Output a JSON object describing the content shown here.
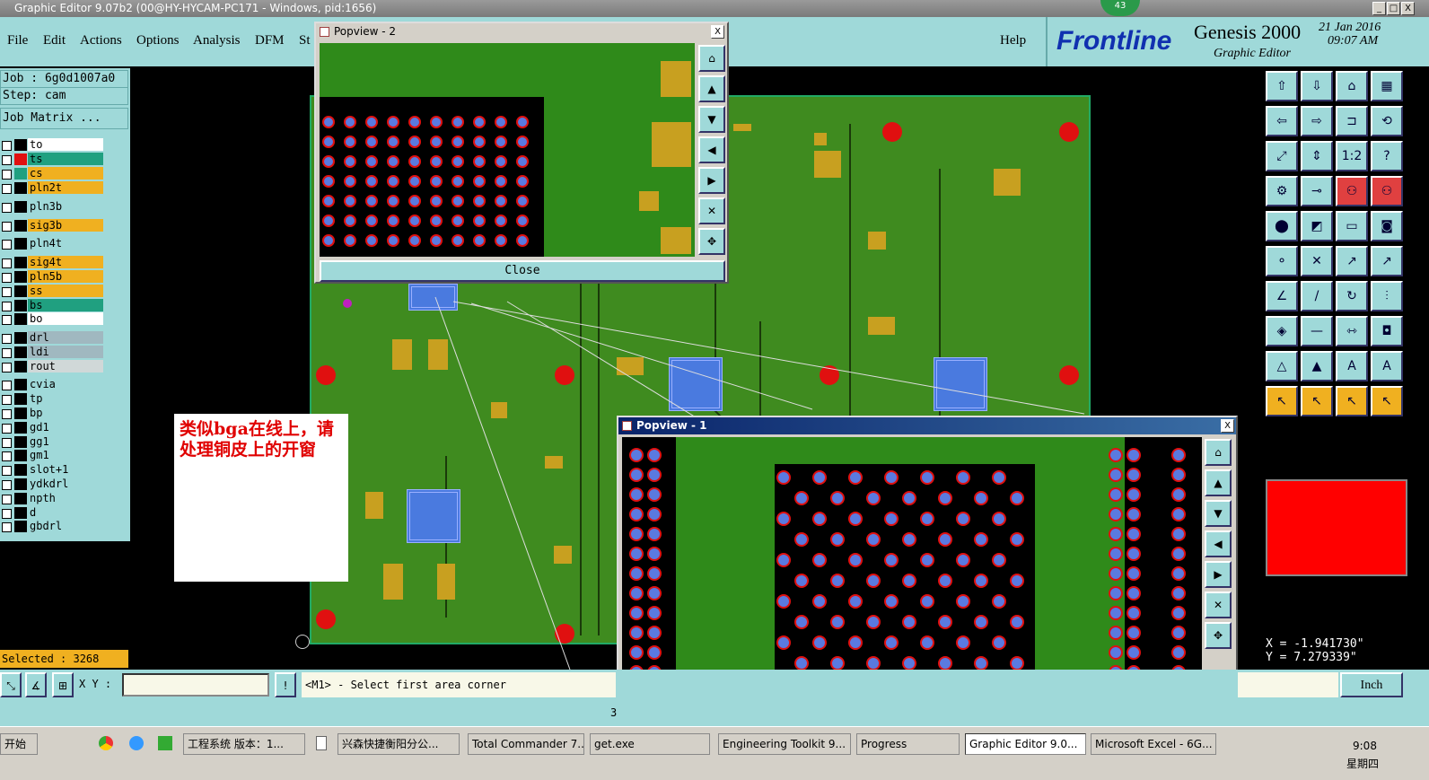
{
  "window": {
    "title": "Graphic Editor 9.07b2 (00@HY-HYCAM-PC171 - Windows, pid:1656)",
    "badge": "43",
    "minimize": "_",
    "maximize": "□",
    "close": "X"
  },
  "menu": {
    "file": "File",
    "edit": "Edit",
    "actions": "Actions",
    "options": "Options",
    "analysis": "Analysis",
    "dfm": "DFM",
    "step": "St",
    "help": "Help"
  },
  "header": {
    "brand": "Frontline",
    "product": "Genesis 2000",
    "subtitle": "Graphic Editor",
    "date": "21 Jan 2016",
    "time": "09:07 AM"
  },
  "left": {
    "job": "Job : 6g0d1007a0",
    "step": "Step: cam",
    "job_matrix": "Job Matrix ...",
    "selected": "Selected : 3268",
    "layers": [
      {
        "name": "to",
        "color": "#ffffff",
        "bg": "#ffffff"
      },
      {
        "name": "ts",
        "color": "#e01010",
        "bg": "#20a080"
      },
      {
        "name": "cs",
        "color": "#20a080",
        "bg": "#f0b020"
      },
      {
        "name": "pln2t",
        "color": "#000000",
        "bg": "#f0b020"
      },
      {
        "name": "pln3b",
        "color": "#000000",
        "bg": "#9fd9d9"
      },
      {
        "name": "sig3b",
        "color": "#000000",
        "bg": "#f0b020"
      },
      {
        "name": "pln4t",
        "color": "#000000",
        "bg": "#9fd9d9"
      },
      {
        "name": "sig4t",
        "color": "#000000",
        "bg": "#f0b020"
      },
      {
        "name": "pln5b",
        "color": "#000000",
        "bg": "#f0b020"
      },
      {
        "name": "ss",
        "color": "#000000",
        "bg": "#f0b020"
      },
      {
        "name": "bs",
        "color": "#000000",
        "bg": "#20a080"
      },
      {
        "name": "bo",
        "color": "#000000",
        "bg": "#ffffff"
      },
      {
        "name": "drl",
        "color": "#000000",
        "bg": "#a0b8c0"
      },
      {
        "name": "ldi",
        "color": "#000000",
        "bg": "#a0b8c0"
      },
      {
        "name": "rout",
        "color": "#000000",
        "bg": "#d0d8d8"
      },
      {
        "name": "cvia",
        "color": "#000000",
        "bg": "#9fd9d9"
      },
      {
        "name": "tp",
        "color": "#000000",
        "bg": "#9fd9d9"
      },
      {
        "name": "bp",
        "color": "#000000",
        "bg": "#9fd9d9"
      },
      {
        "name": "gd1",
        "color": "#000000",
        "bg": "#9fd9d9"
      },
      {
        "name": "gg1",
        "color": "#000000",
        "bg": "#9fd9d9"
      },
      {
        "name": "gm1",
        "color": "#000000",
        "bg": "#9fd9d9"
      },
      {
        "name": "slot+1",
        "color": "#000000",
        "bg": "#9fd9d9"
      },
      {
        "name": "ydkdrl",
        "color": "#000000",
        "bg": "#9fd9d9"
      },
      {
        "name": "npth",
        "color": "#000000",
        "bg": "#9fd9d9"
      },
      {
        "name": "d",
        "color": "#000000",
        "bg": "#9fd9d9"
      },
      {
        "name": "gbdrl",
        "color": "#000000",
        "bg": "#9fd9d9"
      }
    ]
  },
  "right": {
    "x": "X = -1.941730\"",
    "y": "Y = 7.279339\"",
    "unit": "Inch"
  },
  "popup2": {
    "title": "Popview - 2",
    "close_button": "Close",
    "x": "X"
  },
  "popup1": {
    "title": "Popview - 1",
    "x": "X"
  },
  "note": {
    "text": "类似bga在线上，请处理铜皮上的开窗"
  },
  "cmd": {
    "xy_label": "X Y :",
    "prompt": "<M1> - Select first area corner",
    "status": "3"
  },
  "taskbar": {
    "start": "开始",
    "items": [
      "工程系统  版本：1...",
      "兴森快捷衡阳分公...",
      "Total Commander 7....",
      "get.exe",
      "Engineering Toolkit 9...",
      "Progress",
      "Graphic Editor 9.0...",
      "Microsoft Excel - 6G..."
    ],
    "clock": "9:08",
    "weekday": "星期四"
  }
}
